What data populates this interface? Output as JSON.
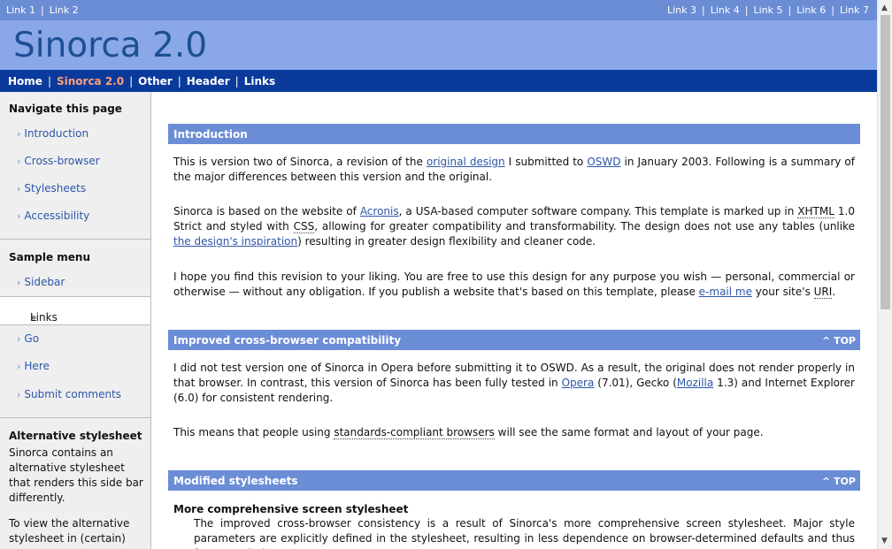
{
  "top_links": {
    "left": [
      "Link 1",
      "Link 2"
    ],
    "right": [
      "Link 3",
      "Link 4",
      "Link 5",
      "Link 6",
      "Link 7"
    ]
  },
  "site_title": "Sinorca 2.0",
  "main_nav": [
    "Home",
    "Sinorca 2.0",
    "Other",
    "Header",
    "Links"
  ],
  "main_nav_active": "Sinorca 2.0",
  "sidebar": {
    "navigate_title": "Navigate this page",
    "navigate_items": [
      "Introduction",
      "Cross-browser",
      "Stylesheets",
      "Accessibility"
    ],
    "sample_title": "Sample menu",
    "sample_items": [
      "Sidebar",
      "Links",
      "Go",
      "Here",
      "Submit comments"
    ],
    "current_marker": "»",
    "item_marker": "›",
    "alt_title": "Alternative stylesheet",
    "alt_text_1": "Sinorca contains an alternative stylesheet that renders this side bar differently.",
    "alt_text_2": "To view the alternative stylesheet in (certain)"
  },
  "sections": {
    "intro": {
      "title": "Introduction",
      "p1_a": "This is version two of Sinorca, a revision of the ",
      "p1_link1": "original design",
      "p1_b": " I submitted to ",
      "p1_link2": "OSWD",
      "p1_c": " in January 2003. Following is a summary of the major differences between this version and the original.",
      "p2_a": "Sinorca is based on the website of ",
      "p2_link1": "Acronis",
      "p2_b": ", a USA-based computer software company. This template is marked up in ",
      "p2_abbr1": "XHTML",
      "p2_c": " 1.0 Strict and styled with ",
      "p2_abbr2": "CSS",
      "p2_d": ", allowing for greater compatibility and transformability. The design does not use any tables (unlike ",
      "p2_link2": "the design's inspiration",
      "p2_e": ") resulting in greater design flexibility and cleaner code.",
      "p3_a": "I hope you find this revision to your liking. You are free to use this design for any purpose you wish — personal, commercial or otherwise — without any obligation. If you publish a website that's based on this template, please ",
      "p3_link": "e-mail me",
      "p3_b": " your site's ",
      "p3_abbr": "URI",
      "p3_c": "."
    },
    "crossbrowser": {
      "title": "Improved cross-browser compatibility",
      "top": "^ TOP",
      "p1_a": "I did not test version one of Sinorca in Opera before submitting it to OSWD. As a result, the original does not render properly in that browser. In contrast, this version of Sinorca has been fully tested in ",
      "p1_link1": "Opera",
      "p1_b": " (7.01), Gecko (",
      "p1_link2": "Mozilla",
      "p1_c": " 1.3) and Internet Explorer (6.0) for consistent rendering.",
      "p2_a": "This means that people using ",
      "p2_abbr": "standards-compliant browsers",
      "p2_b": " will see the same format and layout of your page."
    },
    "stylesheets": {
      "title": "Modified stylesheets",
      "top": "^ TOP",
      "subhead": "More comprehensive screen stylesheet",
      "p1": "The improved cross-browser consistency is a result of Sinorca's more comprehensive screen stylesheet. Major style parameters are explicitly defined in the stylesheet, resulting in less dependence on browser-determined defaults and thus fewer rendering"
    }
  }
}
